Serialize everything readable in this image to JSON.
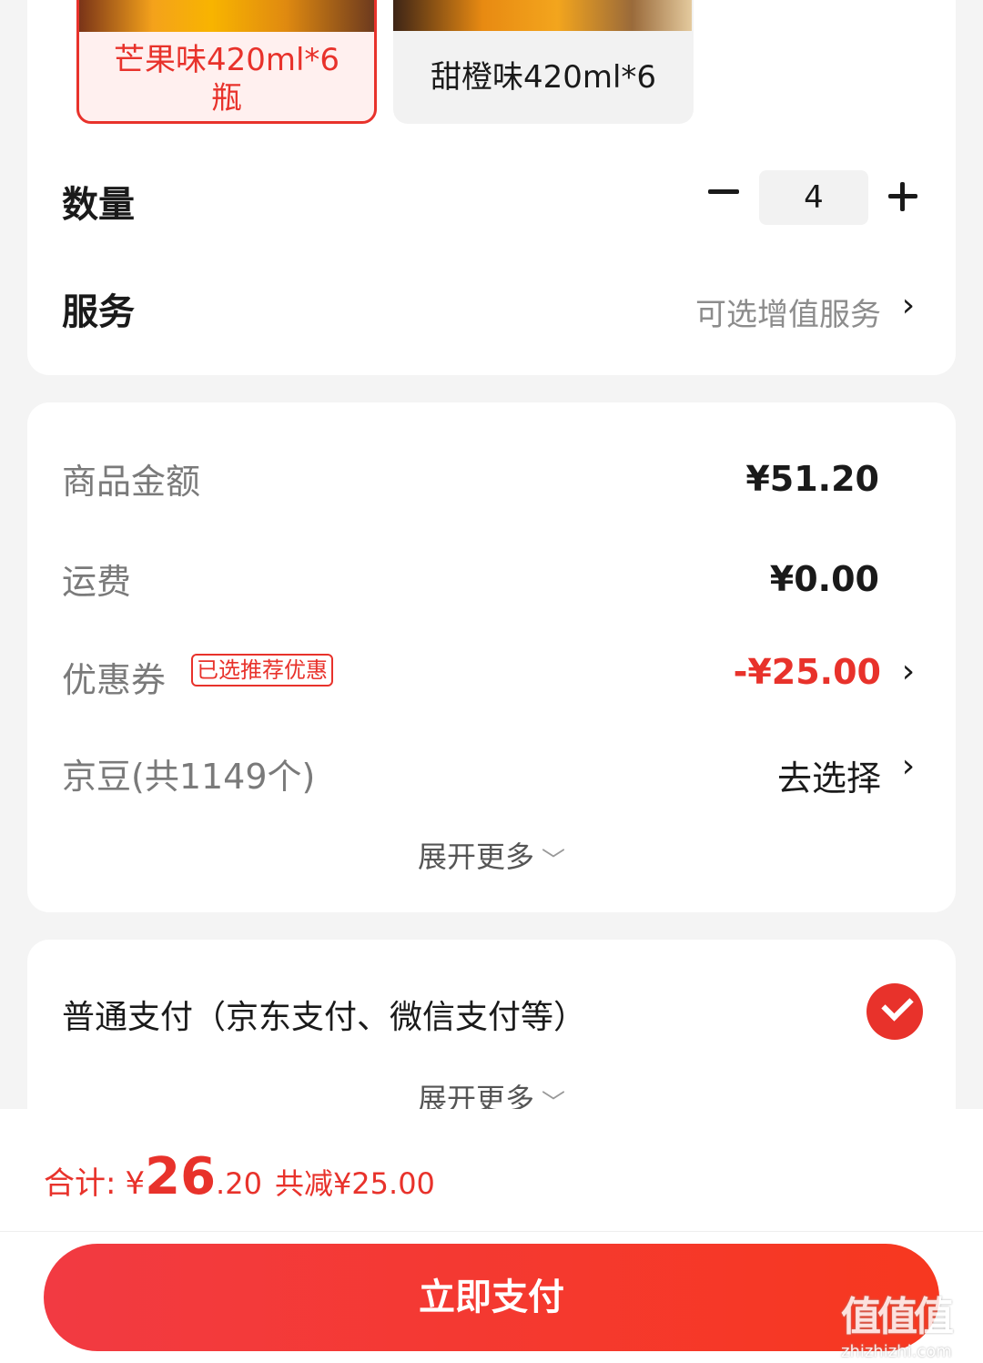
{
  "variants": [
    {
      "label": "芒果味420ml*6\n瓶",
      "selected": true
    },
    {
      "label": "甜橙味420ml*6",
      "selected": false
    }
  ],
  "quantity": {
    "title": "数量",
    "value": "4"
  },
  "service": {
    "title": "服务",
    "value": "可选增值服务"
  },
  "summary": {
    "goods_label": "商品金额",
    "goods_value": "¥51.20",
    "shipping_label": "运费",
    "shipping_value": "¥0.00",
    "coupon_label": "优惠券",
    "coupon_tag": "已选推荐优惠",
    "coupon_value": "-¥25.00",
    "beans_label": "京豆(共1149个)",
    "beans_value": "去选择",
    "expand": "展开更多"
  },
  "payment": {
    "method": "普通支付（京东支付、微信支付等）",
    "expand": "展开更多"
  },
  "footer": {
    "total_label": "合计:",
    "currency": "¥",
    "total_int": "26",
    "total_dec": ".20",
    "saved": "共减¥25.00",
    "pay_button": "立即支付"
  },
  "watermark": {
    "logo": "值值值",
    "url": "zhizhizhi.com"
  },
  "colors": {
    "accent": "#e8322b",
    "background": "#f4f4f4"
  },
  "icons": {
    "chevron": "chevron-right-icon",
    "check": "check-circle-icon"
  }
}
